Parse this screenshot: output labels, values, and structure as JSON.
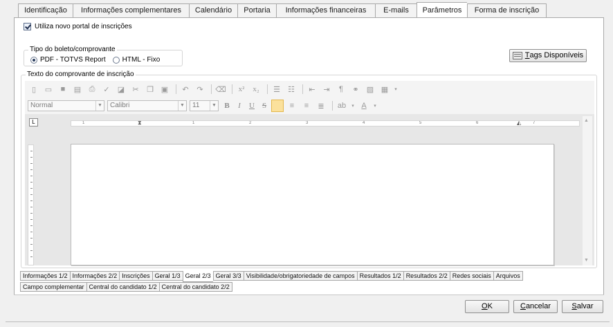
{
  "top_tabs": {
    "items": [
      {
        "label": "Identificação"
      },
      {
        "label": "Informações complementares"
      },
      {
        "label": "Calendário"
      },
      {
        "label": "Portaria"
      },
      {
        "label": "Informações financeiras"
      },
      {
        "label": "E-mails"
      },
      {
        "label": "Parâmetros",
        "active": true
      },
      {
        "label": "Forma de inscrição"
      }
    ]
  },
  "settings": {
    "use_new_portal_label": "Utiliza novo portal de inscrições",
    "use_new_portal_checked": true
  },
  "boleto": {
    "group_label": "Tipo do boleto/comprovante",
    "options": [
      {
        "label": "PDF - TOTVS Report",
        "selected": true
      },
      {
        "label": "HTML - Fixo",
        "selected": false
      }
    ]
  },
  "tags_button": {
    "label_prefix": "",
    "accel": "T",
    "label_rest": "ags Disponíveis",
    "icon": "tag-icon"
  },
  "receipt": {
    "group_label": "Texto do comprovante de inscrição",
    "style_combo": "Normal",
    "font_combo": "Calibri",
    "size_combo": "11",
    "ruler_corner": "L",
    "ruler_numbers": [
      "1",
      "1",
      "2",
      "3",
      "4",
      "5",
      "6",
      "7"
    ]
  },
  "bottom_tabs": {
    "row1": [
      {
        "label": "Informações 1/2"
      },
      {
        "label": "Informações 2/2"
      },
      {
        "label": "Inscrições"
      },
      {
        "label": "Geral 1/3"
      },
      {
        "label": "Geral 2/3",
        "active": true
      },
      {
        "label": "Geral 3/3"
      },
      {
        "label": "Visibilidade/obrigatoriedade de campos"
      },
      {
        "label": "Resultados 1/2"
      },
      {
        "label": "Resultados 2/2"
      },
      {
        "label": "Redes sociais"
      },
      {
        "label": "Arquivos"
      }
    ],
    "row2": [
      {
        "label": "Campo complementar"
      },
      {
        "label": "Central do candidato 1/2"
      },
      {
        "label": "Central do candidato 2/2"
      }
    ]
  },
  "footer": {
    "ok": {
      "accel": "O",
      "rest": "K"
    },
    "cancel": {
      "accel": "C",
      "rest": "ancelar"
    },
    "save": {
      "accel": "S",
      "rest": "alvar"
    }
  }
}
